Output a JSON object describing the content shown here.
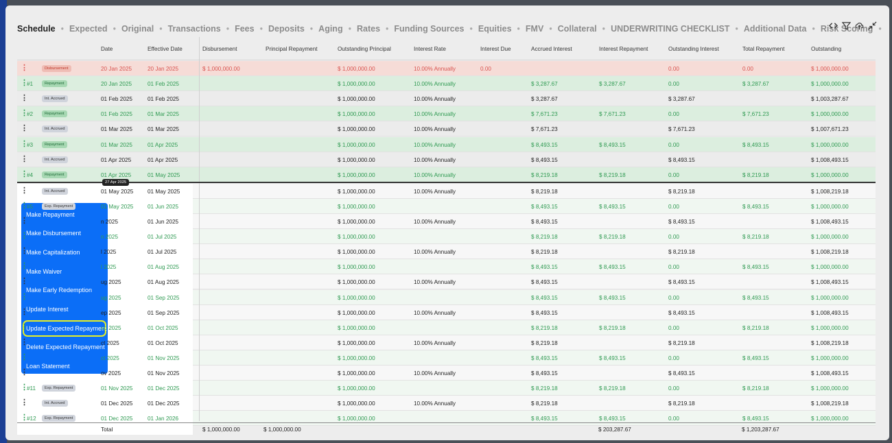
{
  "nav": {
    "tabs": [
      "Schedule",
      "Expected",
      "Original",
      "Transactions",
      "Fees",
      "Deposits",
      "Aging",
      "Rates",
      "Funding Sources",
      "Equities",
      "FMV",
      "Collateral",
      "UNDERWRITING CHECKLIST",
      "Additional Data",
      "Risk Scoring"
    ],
    "active": "Schedule",
    "separator": "•",
    "tools": [
      "code-icon",
      "filter-icon",
      "cloud-upload-icon",
      "collapse-icon"
    ]
  },
  "table": {
    "headers": [
      "Date",
      "Effective Date",
      "Disbursement",
      "Principal Repayment",
      "Outstanding Principal",
      "Interest Rate",
      "Interest Due",
      "Accrued Interest",
      "Interest Repayment",
      "Outstanding Interest",
      "Total Repayment",
      "Outstanding"
    ],
    "rows": [
      {
        "kind": "disb",
        "num": "",
        "badge": "Disbursement",
        "date": "20 Jan 2025",
        "eff": "20 Jan 2025",
        "disb": "$ 1,000,000.00",
        "prin": "",
        "outp": "$ 1,000,000.00",
        "rate": "10.00% Annually",
        "due": "0.00",
        "acc": "",
        "irep": "",
        "outi": "0.00",
        "trep": "0.00",
        "out": "$ 1,000,000.00"
      },
      {
        "kind": "repay",
        "num": "#1",
        "badge": "Repayment",
        "date": "20 Jan 2025",
        "eff": "01 Feb 2025",
        "disb": "",
        "prin": "",
        "outp": "$ 1,000,000.00",
        "rate": "10.00% Annually",
        "due": "",
        "acc": "$ 3,287.67",
        "irep": "$ 3,287.67",
        "outi": "0.00",
        "trep": "$ 3,287.67",
        "out": "$ 1,000,000.00"
      },
      {
        "kind": "acc",
        "num": "",
        "badge": "Int. Accrued",
        "date": "01 Feb 2025",
        "eff": "01 Feb 2025",
        "disb": "",
        "prin": "",
        "outp": "$ 1,000,000.00",
        "rate": "10.00% Annually",
        "due": "",
        "acc": "$ 3,287.67",
        "irep": "",
        "outi": "$ 3,287.67",
        "trep": "",
        "out": "$ 1,003,287.67"
      },
      {
        "kind": "repay",
        "num": "#2",
        "badge": "Repayment",
        "date": "01 Feb 2025",
        "eff": "01 Mar 2025",
        "disb": "",
        "prin": "",
        "outp": "$ 1,000,000.00",
        "rate": "10.00% Annually",
        "due": "",
        "acc": "$ 7,671.23",
        "irep": "$ 7,671.23",
        "outi": "0.00",
        "trep": "$ 7,671.23",
        "out": "$ 1,000,000.00"
      },
      {
        "kind": "acc",
        "num": "",
        "badge": "Int. Accrued",
        "date": "01 Mar 2025",
        "eff": "01 Mar 2025",
        "disb": "",
        "prin": "",
        "outp": "$ 1,000,000.00",
        "rate": "10.00% Annually",
        "due": "",
        "acc": "$ 7,671.23",
        "irep": "",
        "outi": "$ 7,671.23",
        "trep": "",
        "out": "$ 1,007,671.23"
      },
      {
        "kind": "repay",
        "num": "#3",
        "badge": "Repayment",
        "date": "01 Mar 2025",
        "eff": "01 Apr 2025",
        "disb": "",
        "prin": "",
        "outp": "$ 1,000,000.00",
        "rate": "10.00% Annually",
        "due": "",
        "acc": "$ 8,493.15",
        "irep": "$ 8,493.15",
        "outi": "0.00",
        "trep": "$ 8,493.15",
        "out": "$ 1,000,000.00"
      },
      {
        "kind": "acc",
        "num": "",
        "badge": "Int. Accrued",
        "date": "01 Apr 2025",
        "eff": "01 Apr 2025",
        "disb": "",
        "prin": "",
        "outp": "$ 1,000,000.00",
        "rate": "10.00% Annually",
        "due": "",
        "acc": "$ 8,493.15",
        "irep": "",
        "outi": "$ 8,493.15",
        "trep": "",
        "out": "$ 1,008,493.15"
      },
      {
        "kind": "repay",
        "num": "#4",
        "badge": "Repayment",
        "date": "01 Apr 2025",
        "eff": "01 May 2025",
        "disb": "",
        "prin": "",
        "outp": "$ 1,000,000.00",
        "rate": "10.00% Annually",
        "due": "",
        "acc": "$ 8,219.18",
        "irep": "$ 8,219.18",
        "outi": "0.00",
        "trep": "$ 8,219.18",
        "out": "$ 1,000,000.00"
      },
      {
        "kind": "fut-acc",
        "num": "",
        "badge": "Int. Accrued",
        "date": "01 May 2025",
        "eff": "01 May 2025",
        "disb": "",
        "prin": "",
        "outp": "$ 1,000,000.00",
        "rate": "10.00% Annually",
        "due": "",
        "acc": "$ 8,219.18",
        "irep": "",
        "outi": "$ 8,219.18",
        "trep": "",
        "out": "$ 1,008,219.18"
      },
      {
        "kind": "fut-rep",
        "num": "#5",
        "badge": "Exp. Repayment",
        "date": "01 May 2025",
        "eff": "01 Jun 2025",
        "disb": "",
        "prin": "",
        "outp": "$ 1,000,000.00",
        "rate": "",
        "due": "",
        "acc": "$ 8,493.15",
        "irep": "$ 8,493.15",
        "outi": "0.00",
        "trep": "$ 8,493.15",
        "out": "$ 1,000,000.00"
      },
      {
        "kind": "fut-acc",
        "num": "",
        "badge": "",
        "date": "n 2025",
        "eff": "01 Jun 2025",
        "disb": "",
        "prin": "",
        "outp": "$ 1,000,000.00",
        "rate": "10.00% Annually",
        "due": "",
        "acc": "$ 8,493.15",
        "irep": "",
        "outi": "$ 8,493.15",
        "trep": "",
        "out": "$ 1,008,493.15"
      },
      {
        "kind": "fut-rep",
        "num": "",
        "badge": "",
        "date": "n 2025",
        "eff": "01 Jul 2025",
        "disb": "",
        "prin": "",
        "outp": "$ 1,000,000.00",
        "rate": "",
        "due": "",
        "acc": "$ 8,219.18",
        "irep": "$ 8,219.18",
        "outi": "0.00",
        "trep": "$ 8,219.18",
        "out": "$ 1,000,000.00"
      },
      {
        "kind": "fut-acc",
        "num": "",
        "badge": "",
        "date": "l 2025",
        "eff": "01 Jul 2025",
        "disb": "",
        "prin": "",
        "outp": "$ 1,000,000.00",
        "rate": "10.00% Annually",
        "due": "",
        "acc": "$ 8,219.18",
        "irep": "",
        "outi": "$ 8,219.18",
        "trep": "",
        "out": "$ 1,008,219.18"
      },
      {
        "kind": "fut-rep",
        "num": "",
        "badge": "",
        "date": "l 2025",
        "eff": "01 Aug 2025",
        "disb": "",
        "prin": "",
        "outp": "$ 1,000,000.00",
        "rate": "",
        "due": "",
        "acc": "$ 8,493.15",
        "irep": "$ 8,493.15",
        "outi": "0.00",
        "trep": "$ 8,493.15",
        "out": "$ 1,000,000.00"
      },
      {
        "kind": "fut-acc",
        "num": "",
        "badge": "",
        "date": "ug 2025",
        "eff": "01 Aug 2025",
        "disb": "",
        "prin": "",
        "outp": "$ 1,000,000.00",
        "rate": "10.00% Annually",
        "due": "",
        "acc": "$ 8,493.15",
        "irep": "",
        "outi": "$ 8,493.15",
        "trep": "",
        "out": "$ 1,008,493.15"
      },
      {
        "kind": "fut-rep",
        "num": "",
        "badge": "",
        "date": "ug 2025",
        "eff": "01 Sep 2025",
        "disb": "",
        "prin": "",
        "outp": "$ 1,000,000.00",
        "rate": "",
        "due": "",
        "acc": "$ 8,493.15",
        "irep": "$ 8,493.15",
        "outi": "0.00",
        "trep": "$ 8,493.15",
        "out": "$ 1,000,000.00"
      },
      {
        "kind": "fut-acc",
        "num": "",
        "badge": "",
        "date": "ep 2025",
        "eff": "01 Sep 2025",
        "disb": "",
        "prin": "",
        "outp": "$ 1,000,000.00",
        "rate": "10.00% Annually",
        "due": "",
        "acc": "$ 8,493.15",
        "irep": "",
        "outi": "$ 8,493.15",
        "trep": "",
        "out": "$ 1,008,493.15"
      },
      {
        "kind": "fut-rep",
        "num": "",
        "badge": "",
        "date": "ep 2025",
        "eff": "01 Oct 2025",
        "disb": "",
        "prin": "",
        "outp": "$ 1,000,000.00",
        "rate": "",
        "due": "",
        "acc": "$ 8,219.18",
        "irep": "$ 8,219.18",
        "outi": "0.00",
        "trep": "$ 8,219.18",
        "out": "$ 1,000,000.00"
      },
      {
        "kind": "fut-acc",
        "num": "",
        "badge": "",
        "date": "ct 2025",
        "eff": "01 Oct 2025",
        "disb": "",
        "prin": "",
        "outp": "$ 1,000,000.00",
        "rate": "10.00% Annually",
        "due": "",
        "acc": "$ 8,219.18",
        "irep": "",
        "outi": "$ 8,219.18",
        "trep": "",
        "out": "$ 1,008,219.18"
      },
      {
        "kind": "fut-rep",
        "num": "",
        "badge": "",
        "date": "ct 2025",
        "eff": "01 Nov 2025",
        "disb": "",
        "prin": "",
        "outp": "$ 1,000,000.00",
        "rate": "",
        "due": "",
        "acc": "$ 8,493.15",
        "irep": "$ 8,493.15",
        "outi": "0.00",
        "trep": "$ 8,493.15",
        "out": "$ 1,000,000.00"
      },
      {
        "kind": "fut-acc",
        "num": "",
        "badge": "",
        "date": "ov 2025",
        "eff": "01 Nov 2025",
        "disb": "",
        "prin": "",
        "outp": "$ 1,000,000.00",
        "rate": "10.00% Annually",
        "due": "",
        "acc": "$ 8,493.15",
        "irep": "",
        "outi": "$ 8,493.15",
        "trep": "",
        "out": "$ 1,008,493.15"
      },
      {
        "kind": "fut-rep",
        "num": "#11",
        "badge": "Exp. Repayment",
        "date": "01 Nov 2025",
        "eff": "01 Dec 2025",
        "disb": "",
        "prin": "",
        "outp": "$ 1,000,000.00",
        "rate": "",
        "due": "",
        "acc": "$ 8,219.18",
        "irep": "$ 8,219.18",
        "outi": "0.00",
        "trep": "$ 8,219.18",
        "out": "$ 1,000,000.00"
      },
      {
        "kind": "fut-acc",
        "num": "",
        "badge": "Int. Accrued",
        "date": "01 Dec 2025",
        "eff": "01 Dec 2025",
        "disb": "",
        "prin": "",
        "outp": "$ 1,000,000.00",
        "rate": "10.00% Annually",
        "due": "",
        "acc": "$ 8,219.18",
        "irep": "",
        "outi": "$ 8,219.18",
        "trep": "",
        "out": "$ 1,008,219.18"
      },
      {
        "kind": "fut-rep",
        "num": "#12",
        "badge": "Exp. Repayment",
        "date": "01 Dec 2025",
        "eff": "01 Jan 2026",
        "disb": "",
        "prin": "",
        "outp": "$ 1,000,000.00",
        "rate": "",
        "due": "",
        "acc": "$ 8,493.15",
        "irep": "$ 8,493.15",
        "outi": "0.00",
        "trep": "$ 8,493.15",
        "out": "$ 1,000,000.00"
      }
    ],
    "tooltip": "27 Apr 2025",
    "total": {
      "label": "Total",
      "disb": "$ 1,000,000.00",
      "prin": "$ 1,000,000.00",
      "irep": "$ 203,287.67",
      "trep": "$ 1,203,287.67"
    }
  },
  "context_menu": {
    "items": [
      "Make Repayment",
      "Make Disbursement",
      "Make Capitalization",
      "Make Waiver",
      "Make Early Redemption",
      "Update Interest",
      "Update Expected Repayment",
      "Delete Expected Repayment",
      "Loan Statement"
    ],
    "highlighted": "Update Expected Repayment"
  }
}
